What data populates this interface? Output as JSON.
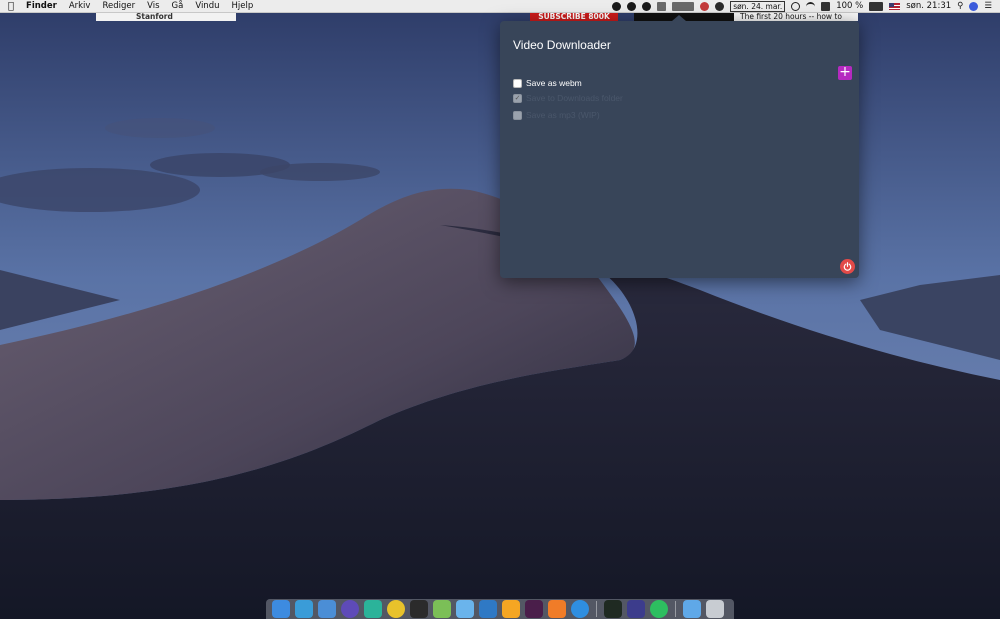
{
  "menubar": {
    "apple_icon": "apple-logo-icon",
    "app_name": "Finder",
    "menus": [
      "Arkiv",
      "Rediger",
      "Vis",
      "Gå",
      "Vindu",
      "Hjelp"
    ],
    "date_box": "søn. 24. mar.",
    "battery": "100 %",
    "clock": "søn. 21:31"
  },
  "background_strip": {
    "left_text": "Stanford",
    "subscribe_text": "SUBSCRIBE 800K",
    "right_text": "The first 20 hours -- how to"
  },
  "popover": {
    "title": "Video Downloader",
    "options": [
      {
        "label": "Save as webm",
        "checked": false,
        "disabled": false
      },
      {
        "label": "Save to Downloads folder",
        "checked": true,
        "disabled": true
      },
      {
        "label": "Save as mp3 (WIP)",
        "checked": false,
        "disabled": true
      }
    ],
    "add_button_icon": "plus-icon",
    "power_button_icon": "power-icon",
    "colors": {
      "panel": "#384559",
      "add": "#b52ac0",
      "power": "#e24a48"
    }
  },
  "dock": {
    "apps": [
      {
        "name": "finder",
        "color": "#3d8be0"
      },
      {
        "name": "xcode",
        "color": "#3a9cd8"
      },
      {
        "name": "xcode-beta",
        "color": "#4b8ed6"
      },
      {
        "name": "focus",
        "color": "#5e4bb8"
      },
      {
        "name": "prompt",
        "color": "#2bb39a"
      },
      {
        "name": "chrome",
        "color": "#e8c22b"
      },
      {
        "name": "terminal",
        "color": "#2b2b2b"
      },
      {
        "name": "android-studio",
        "color": "#7bbf57"
      },
      {
        "name": "folder",
        "color": "#6ab4ec"
      },
      {
        "name": "vscode",
        "color": "#2f79c5"
      },
      {
        "name": "sketch",
        "color": "#f5a623"
      },
      {
        "name": "slack",
        "color": "#4a1e4a"
      },
      {
        "name": "sublime",
        "color": "#f07c28"
      },
      {
        "name": "safari",
        "color": "#2f8ee0"
      },
      {
        "name": "activity-monitor",
        "color": "#1f2a22"
      },
      {
        "name": "reeder",
        "color": "#3c3c8c"
      },
      {
        "name": "evernote",
        "color": "#2dbe60"
      },
      {
        "name": "downloads",
        "color": "#5fa8e8"
      },
      {
        "name": "trash",
        "color": "#c8ccd2"
      }
    ]
  }
}
